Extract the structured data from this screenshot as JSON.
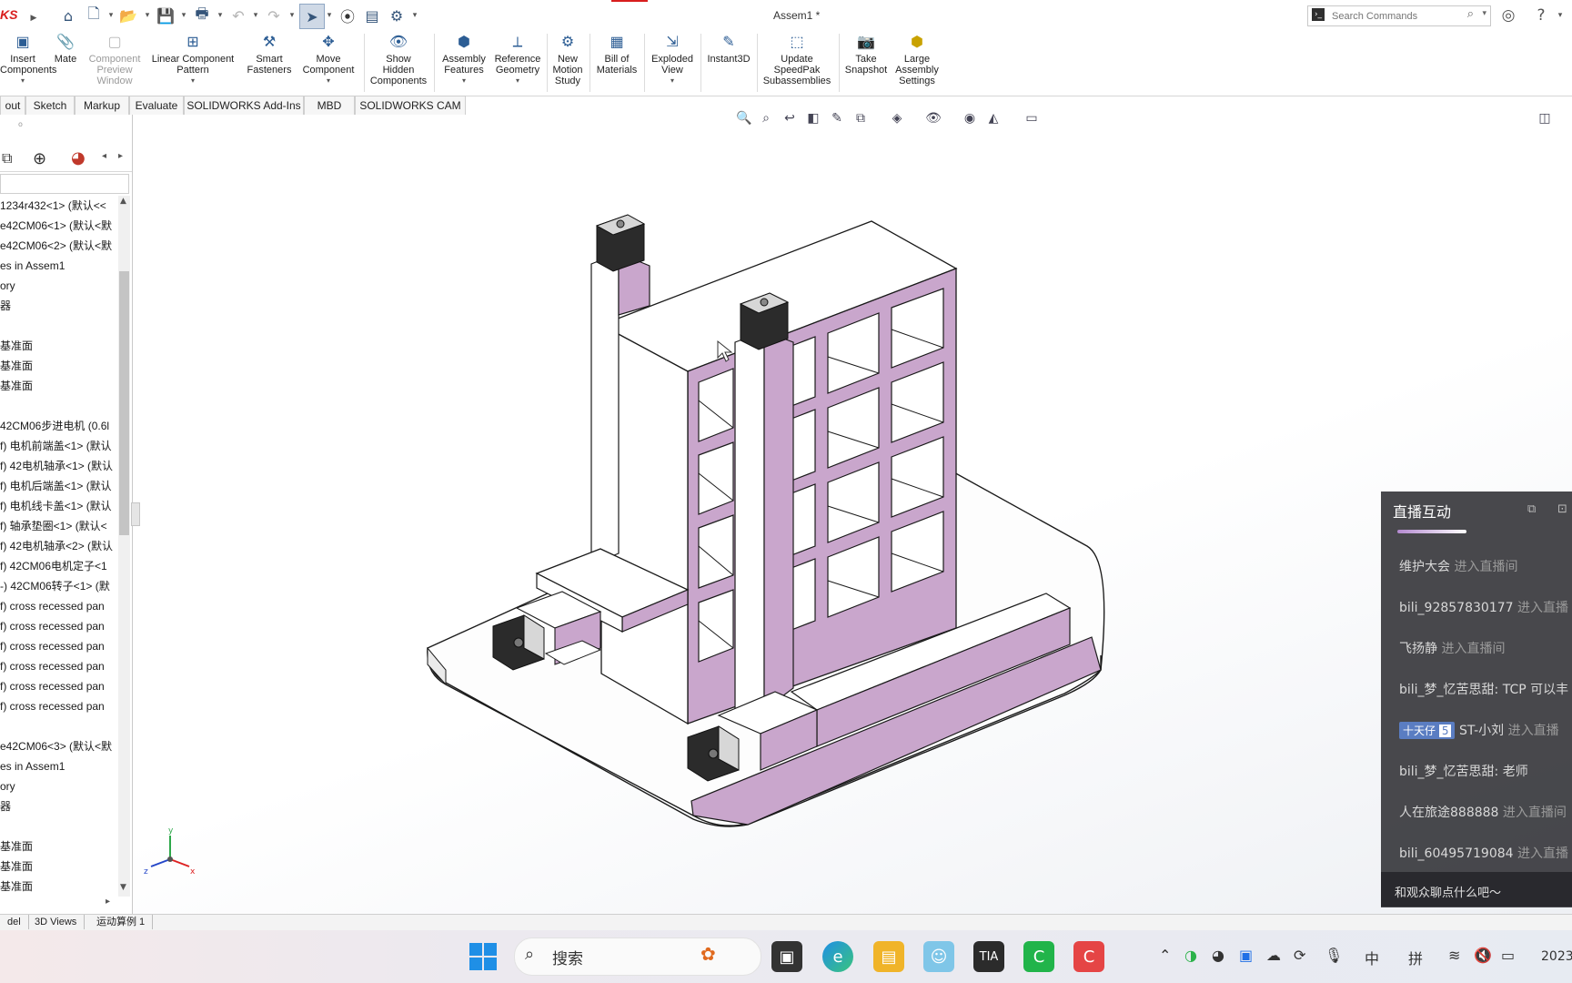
{
  "titlebar": {
    "brand": "KS",
    "document_title": "Assem1 *",
    "search_placeholder": "Search Commands"
  },
  "ribbon": {
    "buttons": [
      {
        "line1": "Insert",
        "line2": "Components",
        "line3": ""
      },
      {
        "line1": "Mate",
        "line2": "",
        "line3": ""
      },
      {
        "line1": "Component",
        "line2": "Preview",
        "line3": "Window"
      },
      {
        "line1": "Linear Component",
        "line2": "Pattern",
        "line3": ""
      },
      {
        "line1": "Smart",
        "line2": "Fasteners",
        "line3": ""
      },
      {
        "line1": "Move",
        "line2": "Component",
        "line3": ""
      },
      {
        "line1": "Show",
        "line2": "Hidden",
        "line3": "Components"
      },
      {
        "line1": "Assembly",
        "line2": "Features",
        "line3": ""
      },
      {
        "line1": "Reference",
        "line2": "Geometry",
        "line3": ""
      },
      {
        "line1": "New",
        "line2": "Motion",
        "line3": "Study"
      },
      {
        "line1": "Bill of",
        "line2": "Materials",
        "line3": ""
      },
      {
        "line1": "Exploded",
        "line2": "View",
        "line3": ""
      },
      {
        "line1": "Instant3D",
        "line2": "",
        "line3": ""
      },
      {
        "line1": "Update",
        "line2": "SpeedPak",
        "line3": "Subassemblies"
      },
      {
        "line1": "Take",
        "line2": "Snapshot",
        "line3": ""
      },
      {
        "line1": "Large",
        "line2": "Assembly",
        "line3": "Settings"
      }
    ]
  },
  "command_tabs": [
    "out",
    "Sketch",
    "Markup",
    "Evaluate",
    "SOLIDWORKS Add-Ins",
    "MBD",
    "SOLIDWORKS CAM"
  ],
  "feature_tree": {
    "items": [
      "1234r432<1> (默认<<",
      "e42CM06<1> (默认<默",
      "e42CM06<2> (默认<默",
      "es in Assem1",
      "ory",
      "器",
      "",
      "基准面",
      "基准面",
      "基准面",
      "",
      "42CM06步进电机 (0.6l",
      "f) 电机前端盖<1> (默认",
      "f) 42电机轴承<1> (默认",
      "f) 电机后端盖<1> (默认",
      "f) 电机线卡盖<1> (默认",
      "f) 轴承垫圈<1> (默认<",
      "f) 42电机轴承<2> (默认",
      "f) 42CM06电机定子<1",
      "-) 42CM06转子<1> (默",
      "f) cross recessed pan",
      "f) cross recessed pan",
      "f) cross recessed pan",
      "f) cross recessed pan",
      "f) cross recessed pan",
      "f) cross recessed pan",
      "",
      "e42CM06<3> (默认<默",
      "es in Assem1",
      "ory",
      "器",
      "",
      "基准面",
      "基准面",
      "基准面"
    ]
  },
  "bottom_tabs": [
    "del",
    "3D Views",
    "运动算例 1"
  ],
  "triad": {
    "x": "x",
    "y": "y",
    "z": "z"
  },
  "live_chat": {
    "title": "直播互动",
    "messages": [
      {
        "user": "维护大会",
        "text": "进入直播间",
        "is_action": true
      },
      {
        "user": "bili_92857830177",
        "text": "进入直播",
        "is_action": true
      },
      {
        "user": "飞扬静",
        "text": "进入直播间",
        "is_action": true
      },
      {
        "user": "bili_梦_忆苦思甜:",
        "text": "TCP 可以丰",
        "is_action": false
      },
      {
        "user": "ST-小刘",
        "text": "进入直播",
        "is_action": true,
        "badge": "十天仔",
        "badge_level": "5"
      },
      {
        "user": "bili_梦_忆苦思甜:",
        "text": "老师",
        "is_action": false
      },
      {
        "user": "人在旅途888888",
        "text": "进入直播间",
        "is_action": true
      },
      {
        "user": "bili_60495719084",
        "text": "进入直播",
        "is_action": true
      }
    ],
    "input_placeholder": "和观众聊点什么吧～"
  },
  "taskbar": {
    "search_label": "搜索",
    "ime_lang": "中",
    "ime_mode": "拼",
    "clock_year": "2023"
  },
  "colors": {
    "accent_pink": "#c9a6cc",
    "model_white": "#fafafa",
    "chat_bg": "#3a3a3e"
  }
}
